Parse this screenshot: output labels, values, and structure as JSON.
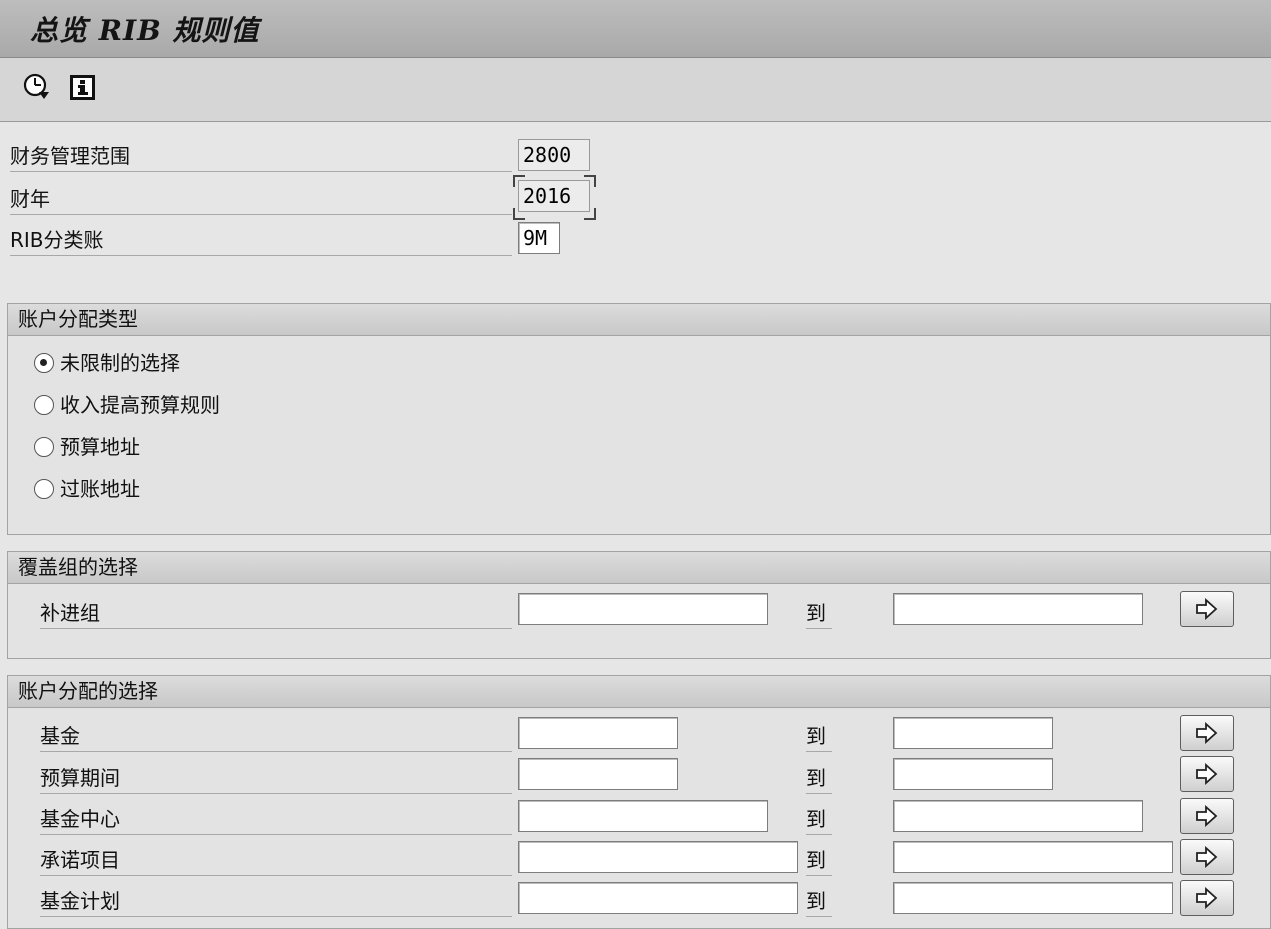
{
  "window": {
    "title": "总览 RIB 规则值"
  },
  "toolbar": {
    "execute_icon": "execute-clock-icon",
    "info_icon": "info-icon"
  },
  "header_fields": [
    {
      "label": "财务管理范围",
      "value": "2800"
    },
    {
      "label": "财年",
      "value": "2016"
    },
    {
      "label": "RIB分类账",
      "value": "9M"
    }
  ],
  "account_type": {
    "title": "账户分配类型",
    "options": [
      "未限制的选择",
      "收入提高预算规则",
      "预算地址",
      "过账地址"
    ],
    "selected_index": 0
  },
  "cover_group": {
    "title": "覆盖组的选择",
    "rows": [
      {
        "label": "补进组",
        "from": "",
        "to": ""
      }
    ]
  },
  "account_sel": {
    "title": "账户分配的选择",
    "rows": [
      {
        "label": "基金",
        "from": "",
        "to": ""
      },
      {
        "label": "预算期间",
        "from": "",
        "to": ""
      },
      {
        "label": "基金中心",
        "from": "",
        "to": ""
      },
      {
        "label": "承诺项目",
        "from": "",
        "to": ""
      },
      {
        "label": "基金计划",
        "from": "",
        "to": ""
      }
    ]
  },
  "common": {
    "to_label": "到",
    "multi_select_icon": "arrow-right-icon"
  }
}
